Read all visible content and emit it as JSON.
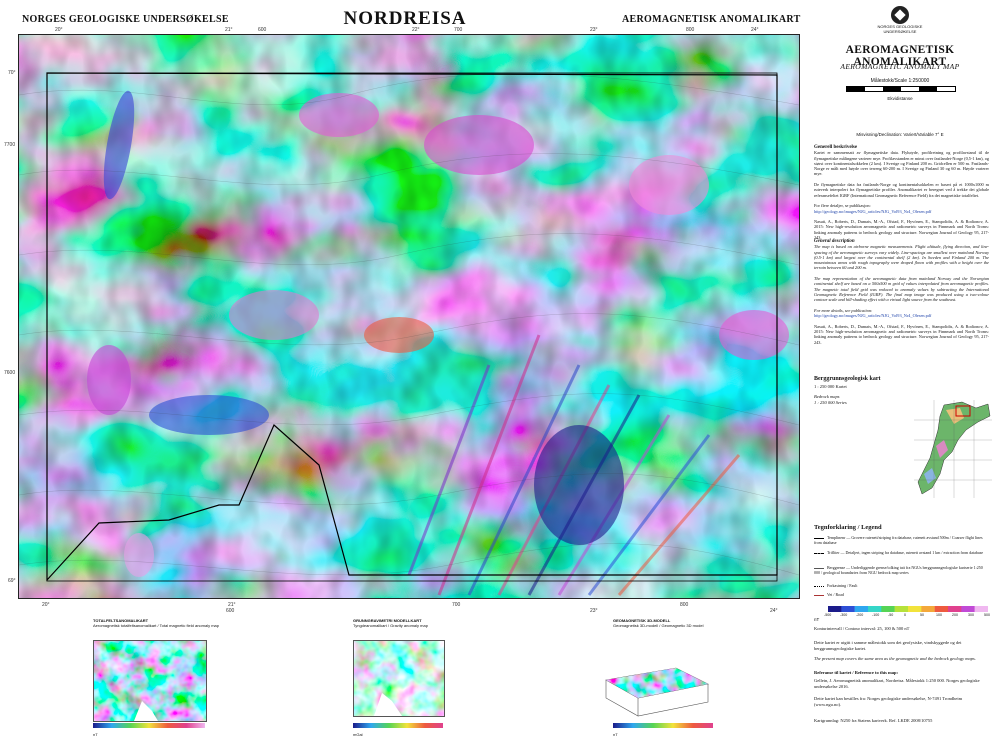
{
  "header": {
    "left": "NORGES GEOLOGISKE UNDERSØKELSE",
    "center": "NORDREISA",
    "right": "AEROMAGNETISK ANOMALIKART"
  },
  "panel": {
    "logo_text": "NORGES GEOLOGISKE UNDERSØKELSE",
    "title": "AEROMAGNETISK ANOMALIKART",
    "subtitle": "AEROMAGNETIC ANOMALY MAP",
    "scale": "Målestokk/Scale 1:250000",
    "ekvidistanse": "Ekvidistanse",
    "misvisning": "Misvisning/Declination: Variert/Variable 7° E",
    "general_title": "Generell beskrivelse",
    "general_text": "Kartet er sammensatt av flymagnetiske data. Flyhøyde, profilretning og profilavstand til de flymagnetiske målingene varierer mye. Profilavstanden er minst over fastlandet-Norge (0,5-1 km), og størst over kontinentalsokkelen (2 km). I Sverige og Finland 200 m. Gridcellen er 500 m. Fastlands-Norge er målt med høyde over terreng 60-200 m. I Sverige og Finland 30 og 60 m. Høyde varierer mye.",
    "general_text2": "De flymagnetiske data fra fastlands-Norge og kontinentalsokkelen er basert på et 1000x1000 m ruteverk interpolert fra flymagnetiske profiler. Anomalikartet er beregnet ved å trekke det globale referansefeltet IGRF (International Geomagnetic Reference Field) fra det magnetiske totalfeltet.",
    "more_info": "For flere detaljer, se publikasjon:",
    "link": "http://geology.no/images/NJG_articles/NJG_Vol93_Nr4_Olesen.pdf",
    "ref_text": "Nasuti, A., Roberts, D., Dumais, M.-A., Ofstad, F., Hyvönen, E., Stampolidis, A. & Rodionov, A. 2015: New high-resolution aeromagnetic and radiometric surveys in Finnmark and North Troms: linking anomaly patterns to bedrock geology and structure. Norwegian Journal of Geology 95, 217-243.",
    "desc_title": "General description",
    "desc_text": "The map is based on airborne magnetic measurements. Flight altitude, flying direction, and line-spacing of the aeromagnetic surveys vary widely. Line-spacings are smallest over mainland Norway (0.5-1 km) and largest over the continental shelf (2 km). In Sweden and Finland 200 m. The mountainous areas with rough topography were draped flown with profiles with a height over the terrain between 60 and 200 m.",
    "desc_text2": "The map representation of the aeromagnetic data from mainland Norway and the Norwegian continental shelf are based on a 500x500 m grid of values interpolated from aeromagnetic profiles. The magnetic total field grid was reduced to anomaly values by subtracting the International Geomagnetic Reference Field (IGRF). The final map image was produced using a two-colour contour scale and hill-shading effect with a virtual light source from the southeast.",
    "more_pub": "For more details, see publication:",
    "bedrock_title": "Berggrunnsgeologisk kart",
    "bedrock_scale": "1 : 250 000 Kartet",
    "bedrock_sub": "Bedrock maps",
    "bedrock_sub2": "1 : 250 000 Series",
    "legend_title": "Tegnforklaring / Legend",
    "legend": [
      "Templinenr — Grovere rutenett/striping fra database, rutenett avstand 500m / Coarser flight lines from database",
      "Trifliter — Detaljert, ingen striping fra database, rutenett avstand 1 km / extraction from database",
      "Berggrense — Underliggende grense/tolking tatt fra NGUs berggrunnsgeologiske kartserie 1:250 000 / geological boundaries from NGU bedrock map series",
      "Forkastning / Fault",
      "Vei / Road"
    ],
    "scale_ticks": [
      "-500",
      "-300",
      "-200",
      "-100",
      "-50",
      "0",
      "50",
      "100",
      "200",
      "300",
      "500"
    ],
    "nT_label": "nT",
    "contour_label": "Konturintervall / Contour interval: 25, 100 & 500 nT",
    "note": "Dette kartet er utgitt i samme målestokk som det geofysiske, vindskyggede og det berggrunnsgeologiske kartet.",
    "note_en": "The present map covers the same area as the geomagnetic and the bedrock geology maps.",
    "ref_title": "Referanse til kartet / Reference to this map:",
    "ref_map": "Gellein, J. Aeromagnetisk anomalikart, Nordreisa. Målestokk 1:250 000. Norges geologiske undersøkelse 2016.",
    "order": "Dette kartet kan bestilles fra: Norges geologiske undersøkelse, N-7491 Trondheim (www.ngu.no).",
    "kartgrunnlag": "Kartgrunnlag: N250 fra Statens kartverk. Ref. LKDE 2008/10755"
  },
  "grid": {
    "top": [
      "20°",
      "21°",
      "22°",
      "23°",
      "24°"
    ],
    "top_km": [
      "600",
      "700",
      "800"
    ],
    "left": [
      "70°",
      "7700",
      "7600",
      "69°"
    ],
    "bottom": [
      "20°",
      "21°",
      "600",
      "700",
      "800",
      "23°",
      "24°"
    ]
  },
  "insets": [
    {
      "title": "TOTALFELTSANOMALIKART",
      "sub": "Aeromagnetisk totalfeltsanomalikart / Total magnetic field anomaly map",
      "scale_label": "nT"
    },
    {
      "title": "GRUNNGRAVIMETRI MODELLKART",
      "sub": "Tyngdeanomalikart / Gravity anomaly map",
      "scale_label": "mGal"
    },
    {
      "title": "GEOMAGNETISK 3D-MODELL",
      "sub": "Geomagnetisk 3D-modell / Geomagnetic 3D model",
      "scale_label": "nT"
    }
  ],
  "colors": {
    "scale": [
      "#1b1b8a",
      "#2e4fd6",
      "#2fa7ef",
      "#35d6c8",
      "#56d455",
      "#b6e23a",
      "#f2e33b",
      "#f4a83a",
      "#ee5a3f",
      "#e0418e",
      "#c14ad6",
      "#f0b8f0"
    ]
  }
}
